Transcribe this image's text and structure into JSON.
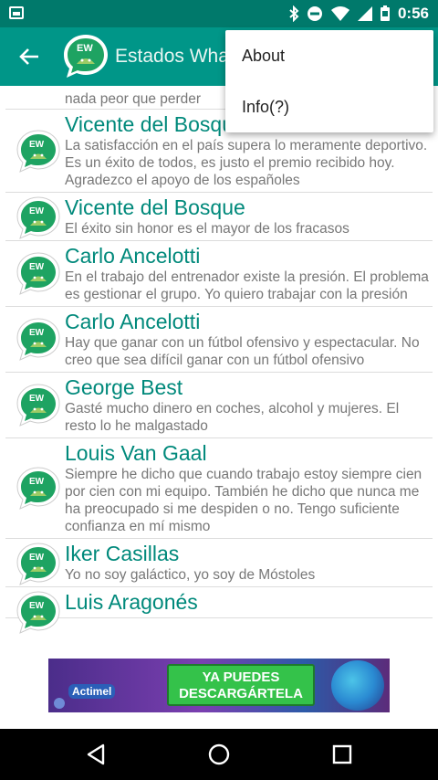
{
  "status_bar": {
    "time": "0:56"
  },
  "app_bar": {
    "title": "Estados WhatsApp"
  },
  "partial_top_text": "nada peor que perder",
  "quotes": [
    {
      "author": "Vicente del Bosque",
      "text": "La satisfacción en el país supera lo meramente deportivo. Es un éxito de todos, es justo el premio recibido hoy. Agradezco el apoyo de los españoles"
    },
    {
      "author": "Vicente del Bosque",
      "text": "El éxito sin honor es el mayor de los fracasos"
    },
    {
      "author": "Carlo Ancelotti",
      "text": "En el trabajo del entrenador existe la presión. El problema es gestionar el grupo. Yo quiero trabajar con la presión"
    },
    {
      "author": "Carlo Ancelotti",
      "text": "Hay que ganar con un fútbol ofensivo y espectacular. No creo que sea difícil ganar con un fútbol ofensivo"
    },
    {
      "author": "George Best",
      "text": "Gasté mucho dinero en coches, alcohol y mujeres. El resto lo he malgastado"
    },
    {
      "author": "Louis Van Gaal",
      "text": "Siempre he dicho que cuando trabajo estoy siempre cien por cien con mi equipo. También he dicho que nunca me ha preocupado si me despiden o no. Tengo suficiente confianza en mí mismo"
    },
    {
      "author": "Iker Casillas",
      "text": "Yo no soy galáctico, yo soy de Móstoles"
    },
    {
      "author": "Luis Aragonés",
      "text": ""
    }
  ],
  "menu": {
    "items": [
      {
        "label": "About"
      },
      {
        "label": "Info(?)"
      }
    ]
  },
  "ad": {
    "brand": "Actimel",
    "cta_line1": "YA PUEDES",
    "cta_line2": "DESCARGÁRTELA"
  },
  "colors": {
    "status_bar": "#00796b",
    "app_bar": "#009688",
    "author_text": "#00897b",
    "quote_text": "#777777"
  }
}
